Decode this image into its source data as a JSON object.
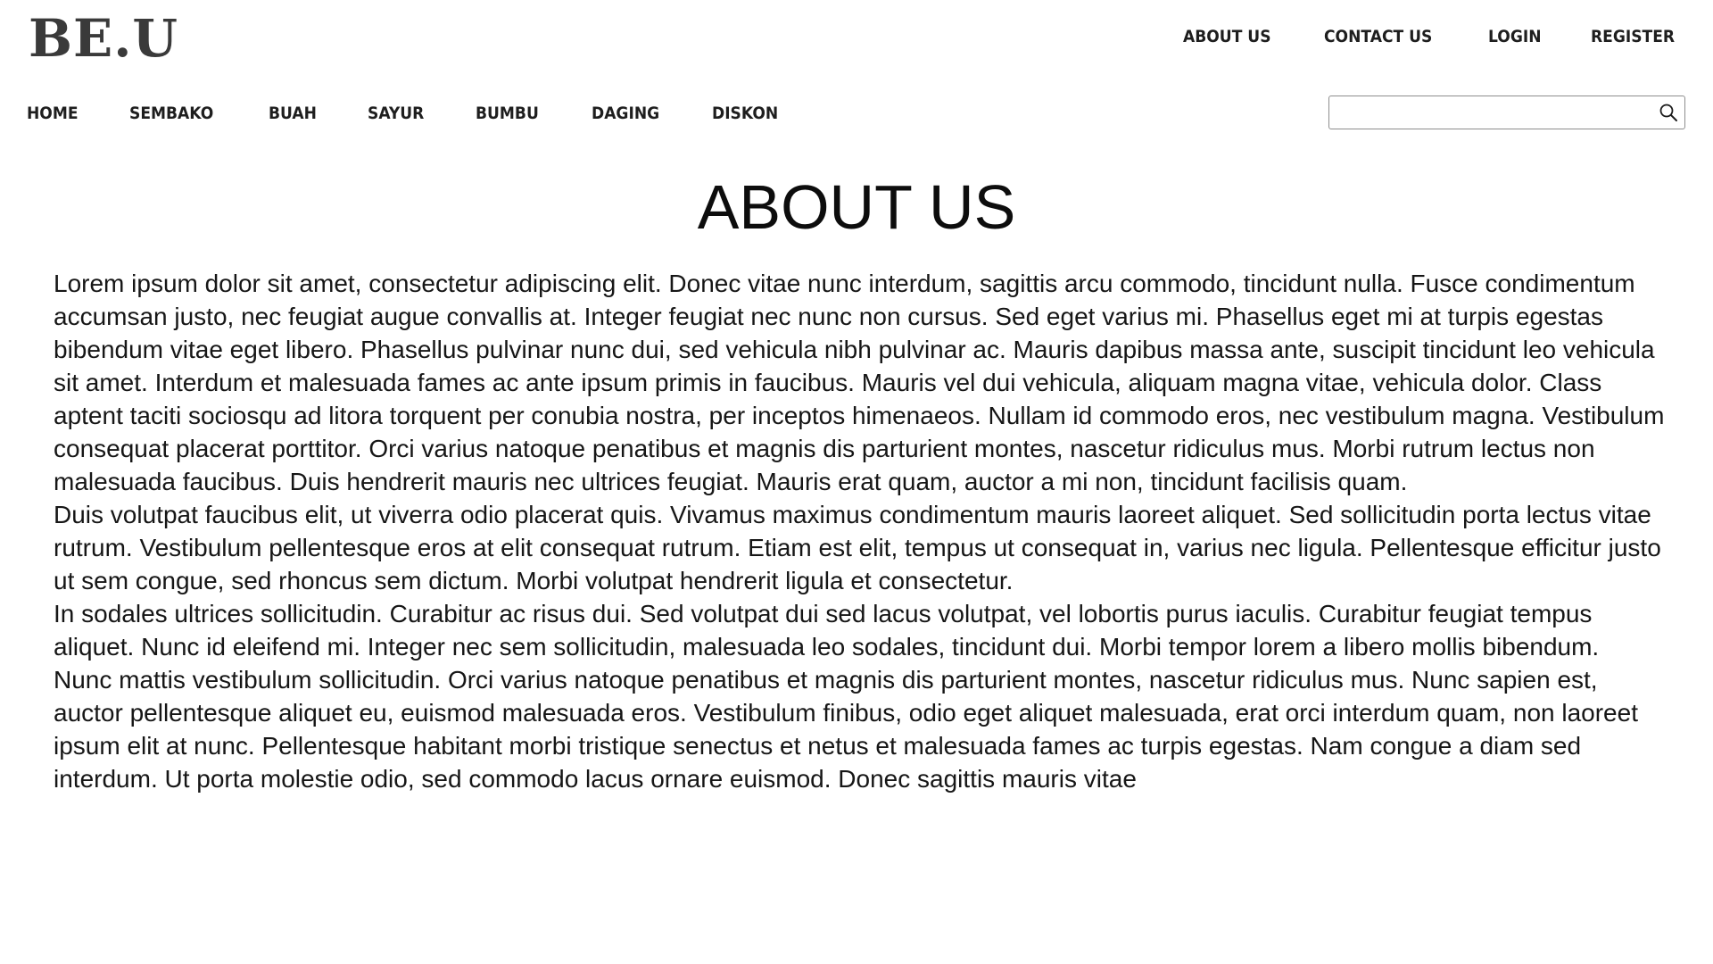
{
  "header": {
    "logo": "BE.U",
    "top_links": [
      "ABOUT US",
      "CONTACT US",
      "LOGIN",
      "REGISTER"
    ]
  },
  "nav": {
    "items": [
      "HOME",
      "SEMBAKO",
      "BUAH",
      "SAYUR",
      "BUMBU",
      "DAGING",
      "DISKON"
    ]
  },
  "search": {
    "value": "",
    "placeholder": "",
    "icon": "search-icon"
  },
  "main": {
    "title": "ABOUT US",
    "paragraphs": [
      "Lorem ipsum dolor sit amet, consectetur adipiscing elit. Donec vitae nunc interdum, sagittis arcu commodo, tincidunt nulla. Fusce condimentum accumsan justo, nec feugiat augue convallis at. Integer feugiat nec nunc non cursus. Sed eget varius mi. Phasellus eget mi at turpis egestas bibendum vitae eget libero. Phasellus pulvinar nunc dui, sed vehicula nibh pulvinar ac. Mauris dapibus massa ante, suscipit tincidunt leo vehicula sit amet. Interdum et malesuada fames ac ante ipsum primis in faucibus. Mauris vel dui vehicula, aliquam magna vitae, vehicula dolor. Class aptent taciti sociosqu ad litora torquent per conubia nostra, per inceptos himenaeos. Nullam id commodo eros, nec vestibulum magna. Vestibulum consequat placerat porttitor. Orci varius natoque penatibus et magnis dis parturient montes, nascetur ridiculus mus. Morbi rutrum lectus non malesuada faucibus. Duis hendrerit mauris nec ultrices feugiat. Mauris erat quam, auctor a mi non, tincidunt facilisis quam.",
      "Duis volutpat faucibus elit, ut viverra odio placerat quis. Vivamus maximus condimentum mauris laoreet aliquet. Sed sollicitudin porta lectus vitae rutrum. Vestibulum pellentesque eros at elit consequat rutrum. Etiam est elit, tempus ut consequat in, varius nec ligula. Pellentesque efficitur justo ut sem congue, sed rhoncus sem dictum. Morbi volutpat hendrerit ligula et consectetur.",
      "In sodales ultrices sollicitudin. Curabitur ac risus dui. Sed volutpat dui sed lacus volutpat, vel lobortis purus iaculis. Curabitur feugiat tempus aliquet. Nunc id eleifend mi. Integer nec sem sollicitudin, malesuada leo sodales, tincidunt dui. Morbi tempor lorem a libero mollis bibendum.",
      "Nunc mattis vestibulum sollicitudin. Orci varius natoque penatibus et magnis dis parturient montes, nascetur ridiculus mus. Nunc sapien est, auctor pellentesque aliquet eu, euismod malesuada eros. Vestibulum finibus, odio eget aliquet malesuada, erat orci interdum quam, non laoreet ipsum elit at nunc. Pellentesque habitant morbi tristique senectus et netus et malesuada fames ac turpis egestas. Nam congue a diam sed interdum. Ut porta molestie odio, sed commodo lacus ornare euismod. Donec sagittis mauris vitae"
    ]
  }
}
